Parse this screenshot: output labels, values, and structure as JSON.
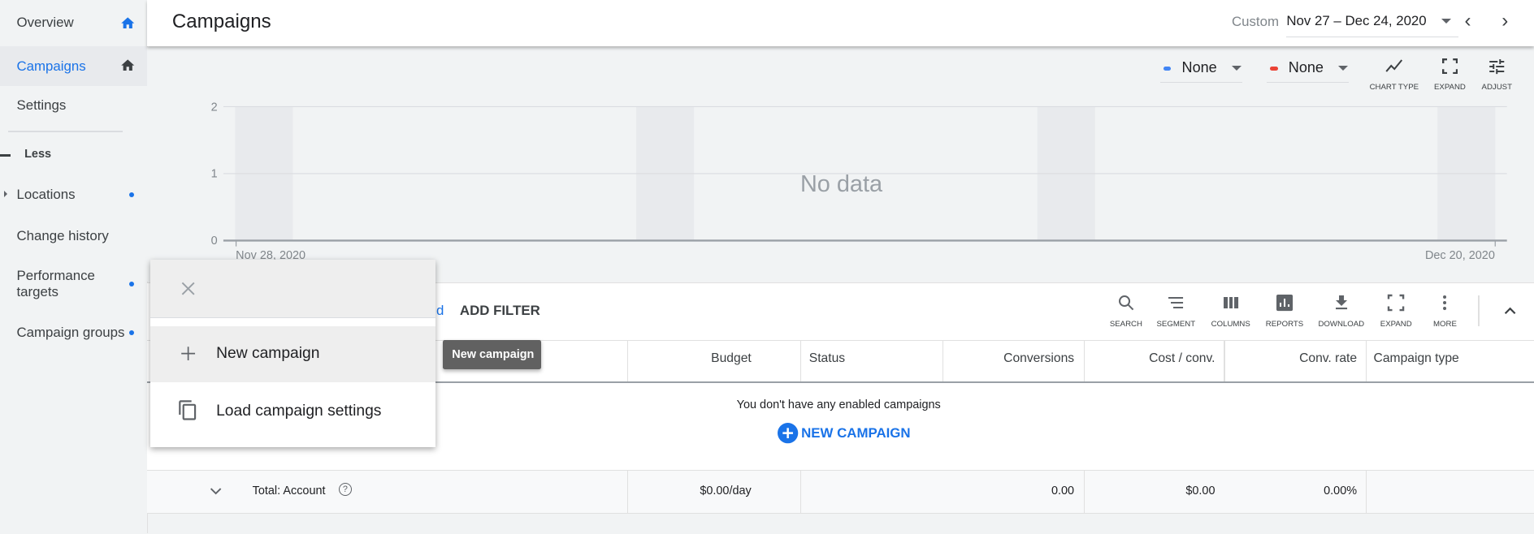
{
  "sidebar": {
    "items": [
      {
        "label": "Overview",
        "icon": "home-icon",
        "color": "#1a73e8"
      },
      {
        "label": "Campaigns",
        "icon": "home-icon",
        "selected": true
      },
      {
        "label": "Settings"
      },
      {
        "label": "Less"
      },
      {
        "label": "Locations"
      },
      {
        "label": "Change history"
      },
      {
        "label": "Performance targets"
      },
      {
        "label": "Campaign groups"
      }
    ]
  },
  "header": {
    "title": "Campaigns",
    "range_label": "Custom",
    "range": "Nov 27 – Dec 24, 2020"
  },
  "chart_controls": {
    "metric1": "None",
    "metric1_color": "#4285f4",
    "metric2": "None",
    "metric2_color": "#ea4335",
    "chart_type": "CHART TYPE",
    "expand": "EXPAND",
    "adjust": "ADJUST"
  },
  "chart_data": {
    "type": "line",
    "series": [],
    "y_ticks": [
      "2",
      "1",
      "0"
    ],
    "ylim": [
      0,
      2
    ],
    "x_labels": [
      "Nov 28, 2020",
      "Dec 20, 2020"
    ],
    "empty_message": "No data",
    "grid": true
  },
  "filter": {
    "chip_fragment": "d",
    "add_filter": "ADD FILTER"
  },
  "toolbar": [
    "SEARCH",
    "SEGMENT",
    "COLUMNS",
    "REPORTS",
    "DOWNLOAD",
    "EXPAND",
    "MORE"
  ],
  "table": {
    "columns": [
      "Budget",
      "Status",
      "Conversions",
      "Cost / conv.",
      "Conv. rate",
      "Campaign type"
    ],
    "empty": "You don't have any enabled campaigns",
    "new_campaign": "NEW CAMPAIGN",
    "total": {
      "label": "Total: Account",
      "budget": "$0.00/day",
      "conversions": "0.00",
      "cost_conv": "$0.00",
      "conv_rate": "0.00%"
    }
  },
  "menu": {
    "items": [
      "New campaign",
      "Load campaign settings"
    ]
  },
  "tooltip": "New campaign"
}
